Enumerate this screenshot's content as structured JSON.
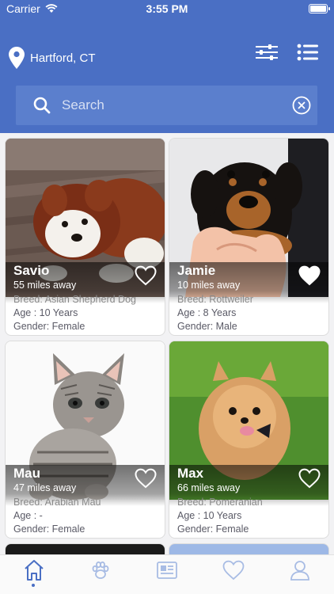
{
  "status_bar": {
    "carrier": "Carrier",
    "time": "3:55 PM"
  },
  "header": {
    "location": "Hartford, CT",
    "search_placeholder": "Search",
    "accent_color": "#4a6fc4"
  },
  "pets": [
    {
      "name": "Savio",
      "distance": "55 miles away",
      "breed": "Breed: Asian Shepherd Dog",
      "age": "Age : 10 Years",
      "gender": "Gender: Female",
      "favorited": false,
      "photo": "puppy-brown-white-toy"
    },
    {
      "name": "Jamie",
      "distance": "10 miles away",
      "breed": "Breed: Rottweiler",
      "age": "Age : 8 Years",
      "gender": "Gender: Male",
      "favorited": true,
      "photo": "rottweiler-puppy"
    },
    {
      "name": "Mau",
      "distance": "47 miles away",
      "breed": "Breed: Arabian Mau",
      "age": "Age : -",
      "gender": "Gender: Female",
      "favorited": false,
      "photo": "tabby-kitten"
    },
    {
      "name": "Max",
      "distance": "66 miles away",
      "breed": "Breed: Pomeranian",
      "age": "Age : 10 Years",
      "gender": "Gender: Female",
      "favorited": false,
      "photo": "pomeranian-on-grass"
    }
  ],
  "tabbar": {
    "tabs": [
      "home-icon",
      "paw-icon",
      "news-icon",
      "heart-icon",
      "profile-icon"
    ],
    "active_tab": "home-icon"
  }
}
